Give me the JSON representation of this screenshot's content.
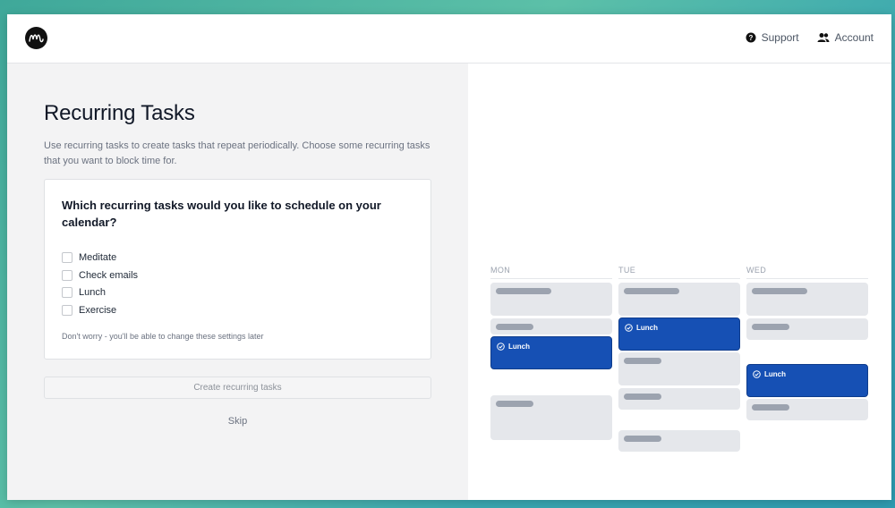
{
  "header": {
    "support_label": "Support",
    "account_label": "Account"
  },
  "main": {
    "title": "Recurring Tasks",
    "description": "Use recurring tasks to create tasks that repeat periodically. Choose some recurring tasks that you want to block time for.",
    "question": "Which recurring tasks would you like to schedule on your calendar?",
    "options": [
      "Meditate",
      "Check emails",
      "Lunch",
      "Exercise"
    ],
    "note": "Don't worry - you'll be able to change these settings later",
    "create_button": "Create recurring tasks",
    "skip_label": "Skip"
  },
  "calendar": {
    "days": [
      "MON",
      "TUE",
      "WED"
    ],
    "event_label": "Lunch",
    "event_color": "#1650b4",
    "placeholder_color": "#e5e7eb"
  }
}
